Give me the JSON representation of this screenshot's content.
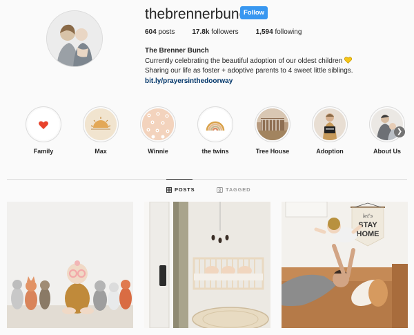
{
  "profile": {
    "username": "thebrennerbunch",
    "follow_label": "Follow",
    "stats": {
      "posts_count": "604",
      "posts_label": "posts",
      "followers_count": "17.8k",
      "followers_label": "followers",
      "following_count": "1,594",
      "following_label": "following"
    },
    "bio": {
      "name": "The Brenner Bunch",
      "line1": "Currently celebrating the beautiful adoption of our oldest children",
      "line2": "Sharing our life as foster + adoptive parents to 4 sweet little siblings.",
      "link": "bit.ly/prayersinthedoorway"
    },
    "colors": {
      "follow_button": "#3897f0",
      "link": "#003569",
      "heart": "#f5c518"
    }
  },
  "highlights": [
    {
      "label": "Family",
      "icon": "heart-icon"
    },
    {
      "label": "Max",
      "icon": "sun-icon"
    },
    {
      "label": "Winnie",
      "icon": "flower-pattern-icon"
    },
    {
      "label": "the twins",
      "icon": "rainbow-icon"
    },
    {
      "label": "Tree House",
      "icon": "tree-house-photo"
    },
    {
      "label": "Adoption",
      "icon": "adoption-photo"
    },
    {
      "label": "About Us",
      "icon": "about-us-photo"
    }
  ],
  "tabs": {
    "posts": "POSTS",
    "tagged": "TAGGED"
  },
  "posts": [
    {
      "alt": "baby-with-plush-toys"
    },
    {
      "alt": "nursery-with-crib"
    },
    {
      "alt": "dad-lifting-baby-stay-home-banner",
      "banner_text_top": "let's",
      "banner_text_1": "STAY",
      "banner_text_2": "HOME"
    }
  ]
}
